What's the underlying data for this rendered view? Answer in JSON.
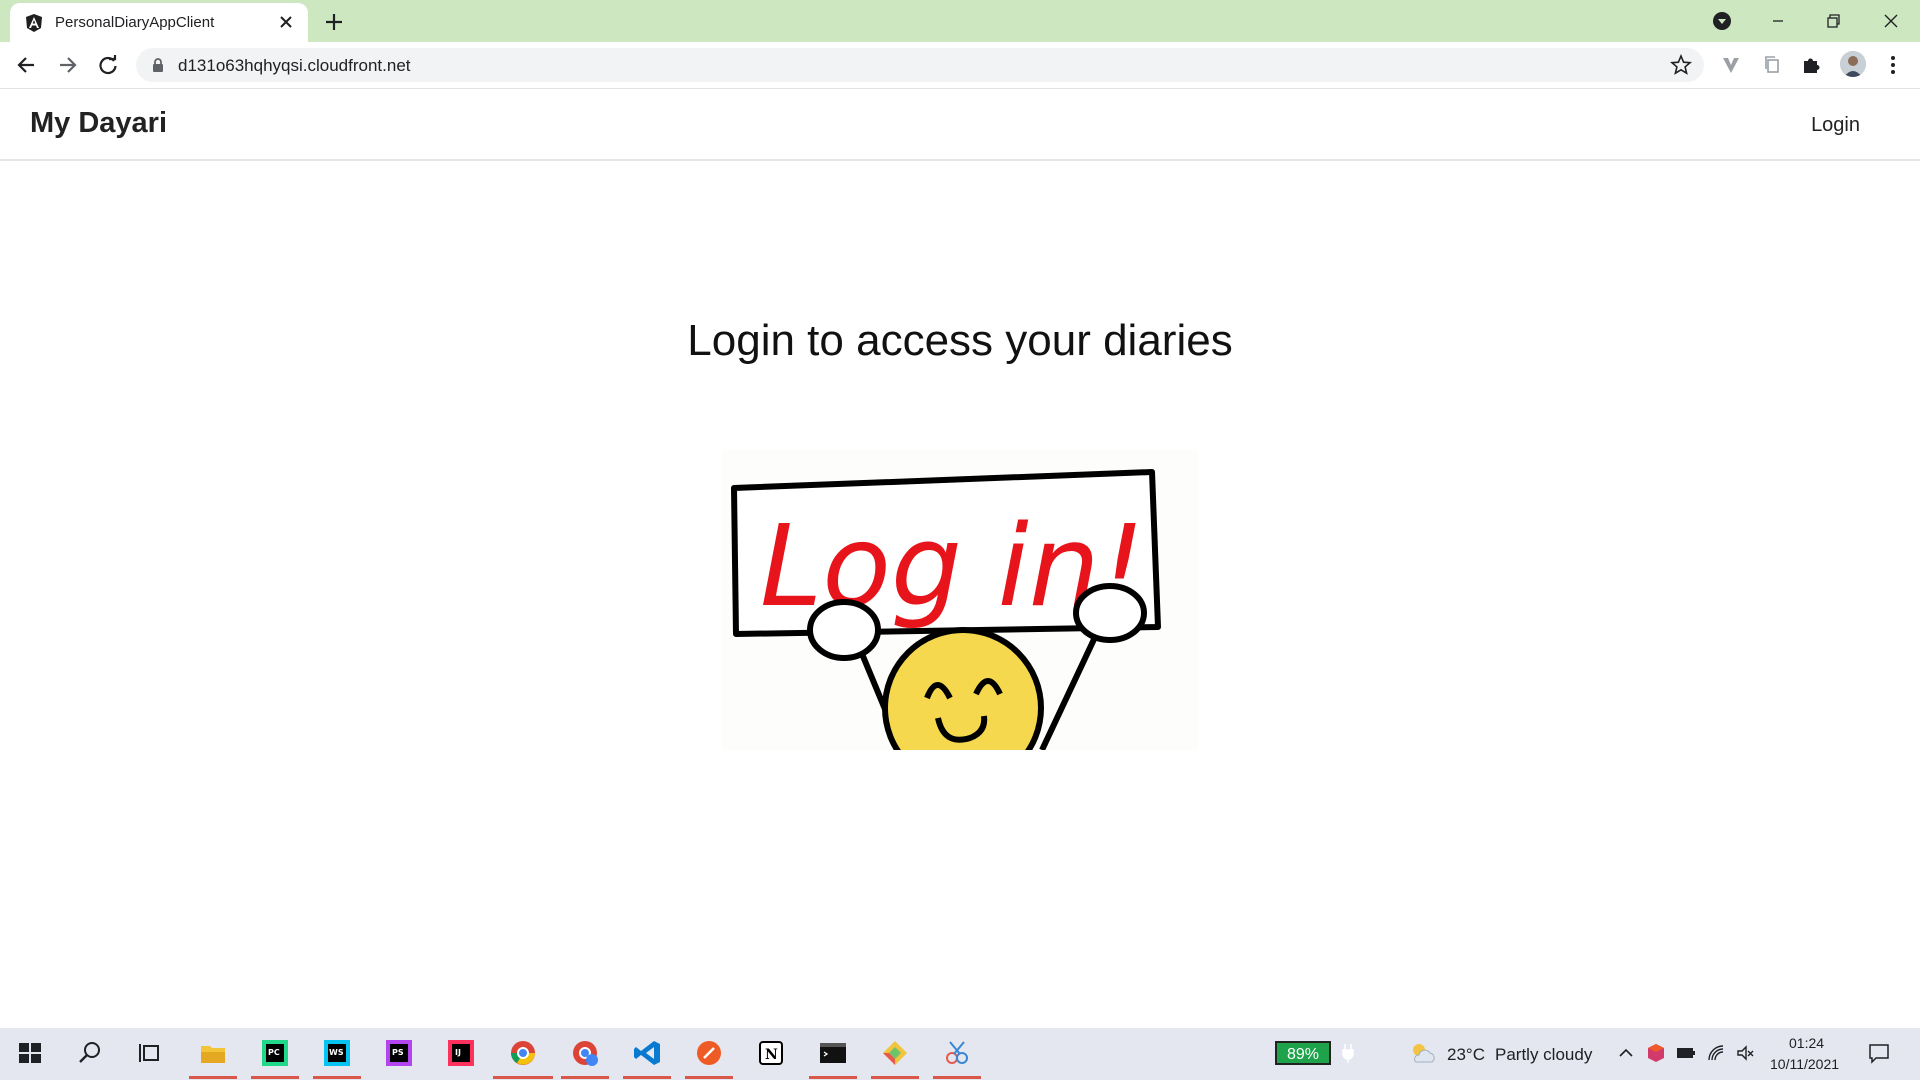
{
  "browser": {
    "tab_title": "PersonalDiaryAppClient",
    "url": "d131o63hqhyqsi.cloudfront.net"
  },
  "page": {
    "brand": "My Dayari",
    "nav_login": "Login",
    "heading": "Login to access your diaries",
    "sign_text": "Log in!"
  },
  "taskbar": {
    "battery": "89%",
    "temperature": "23°C",
    "weather": "Partly cloudy",
    "time": "01:24",
    "date": "10/11/2021",
    "apps": [
      "start-icon",
      "search-icon",
      "task-view-icon",
      "file-explorer-icon",
      "pycharm-icon",
      "webstorm-icon",
      "phpstorm-icon",
      "intellij-icon",
      "chrome-icon",
      "chrome-profile-icon",
      "vscode-icon",
      "postman-icon",
      "notion-icon",
      "terminal-icon",
      "git-icon",
      "snipping-icon"
    ]
  },
  "colors": {
    "tabstrip": "#cde8c0",
    "sign_text": "#e8141b",
    "face": "#f5d84e"
  }
}
